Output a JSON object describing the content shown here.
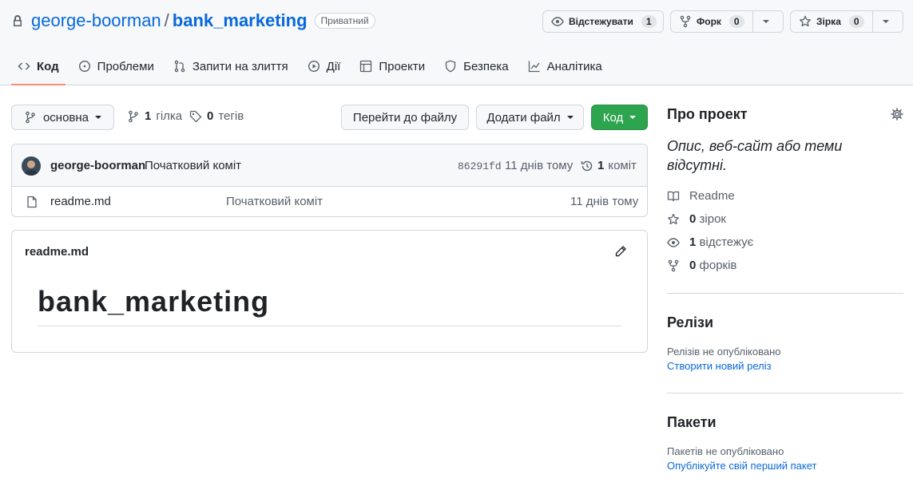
{
  "repo": {
    "owner": "george-boorman",
    "separator": "/",
    "name": "bank_marketing",
    "visibility": "Приватний"
  },
  "header_buttons": {
    "watch": {
      "label": "Відстежувати",
      "count": "1"
    },
    "fork": {
      "label": "Форк",
      "count": "0"
    },
    "star": {
      "label": "Зірка",
      "count": "0"
    }
  },
  "tabs": [
    {
      "label": "Код",
      "icon": "code-icon",
      "active": true
    },
    {
      "label": "Проблеми",
      "icon": "issue-icon"
    },
    {
      "label": "Запити на злиття",
      "icon": "pull-request-icon"
    },
    {
      "label": "Дії",
      "icon": "play-icon"
    },
    {
      "label": "Проекти",
      "icon": "table-icon"
    },
    {
      "label": "Безпека",
      "icon": "shield-icon"
    },
    {
      "label": "Аналітика",
      "icon": "graph-icon"
    }
  ],
  "branch": {
    "current": "основна",
    "branches_count": "1",
    "branches_label": "гілка",
    "tags_count": "0",
    "tags_label": "тегів"
  },
  "actions": {
    "goto_file": "Перейти до файлу",
    "add_file": "Додати файл",
    "code": "Код"
  },
  "latest_commit": {
    "author": "george-boorman",
    "message": "Початковий коміт",
    "sha": "86291fd",
    "time": "11 днів тому",
    "commits_count": "1",
    "commits_label": "коміт"
  },
  "files": [
    {
      "name": "readme.md",
      "message": "Початковий коміт",
      "time": "11 днів тому"
    }
  ],
  "readme": {
    "filename": "readme.md",
    "heading": "bank_marketing"
  },
  "about": {
    "title": "Про проект",
    "description": "Опис, веб-сайт або теми відсутні.",
    "readme_label": "Readme",
    "stars_count": "0",
    "stars_label": "зірок",
    "watchers_count": "1",
    "watchers_label": "відстежує",
    "forks_count": "0",
    "forks_label": "форків"
  },
  "releases": {
    "title": "Релізи",
    "empty": "Релізів не опубліковано",
    "create_link": "Створити новий реліз"
  },
  "packages": {
    "title": "Пакети",
    "empty": "Пакетів не опубліковано",
    "publish_link": "Опублікуйте свій перший пакет"
  },
  "colors": {
    "link": "#0969da",
    "primary_button": "#2da44e",
    "active_tab_underline": "#fd8c73"
  }
}
